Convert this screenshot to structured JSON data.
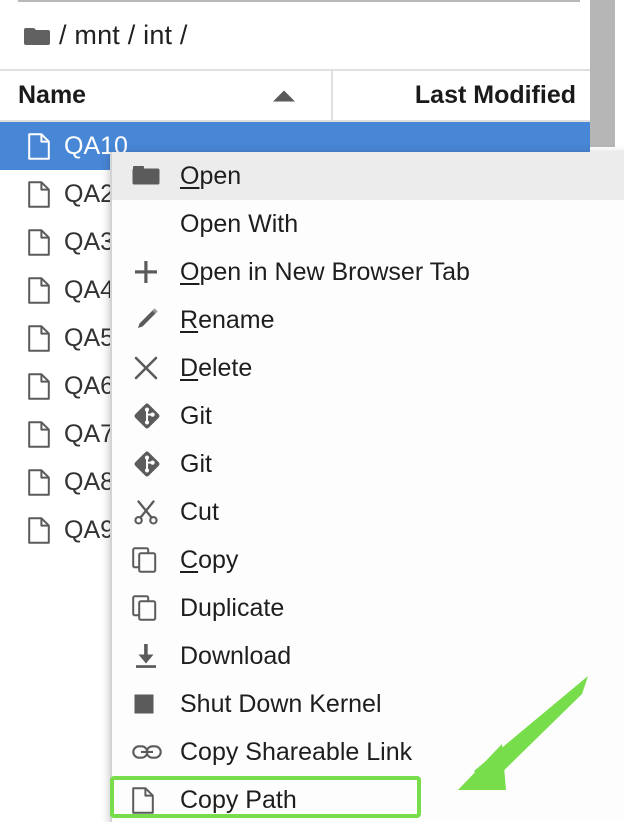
{
  "app": "JupyterLab File Browser",
  "breadcrumb": {
    "icon": "folder-icon",
    "path": "/ mnt / int /"
  },
  "columns": {
    "name": "Name",
    "last_modified": "Last Modified",
    "sort_icon": "caret-up-icon",
    "sort_direction": "ascending",
    "sorted_by": "Name"
  },
  "files": [
    {
      "name": "QA10",
      "icon": "file-icon",
      "selected": true
    },
    {
      "name": "QA2",
      "icon": "file-icon",
      "selected": false
    },
    {
      "name": "QA3",
      "icon": "file-icon",
      "selected": false
    },
    {
      "name": "QA4",
      "icon": "file-icon",
      "selected": false
    },
    {
      "name": "QA5",
      "icon": "file-icon",
      "selected": false
    },
    {
      "name": "QA6",
      "icon": "file-icon",
      "selected": false
    },
    {
      "name": "QA7",
      "icon": "file-icon",
      "selected": false
    },
    {
      "name": "QA8",
      "icon": "file-icon",
      "selected": false
    },
    {
      "name": "QA9",
      "icon": "file-icon",
      "selected": false
    }
  ],
  "context_menu": {
    "items": [
      {
        "label": "Open",
        "mnemonic": "O",
        "icon": "folder-icon",
        "active": true
      },
      {
        "label": "Open With",
        "mnemonic": "",
        "icon": "none",
        "active": false
      },
      {
        "label": "Open in New Browser Tab",
        "mnemonic": "O",
        "icon": "plus-icon",
        "active": false
      },
      {
        "label": "Rename",
        "mnemonic": "R",
        "icon": "pencil-icon",
        "active": false
      },
      {
        "label": "Delete",
        "mnemonic": "D",
        "icon": "close-x-icon",
        "active": false
      },
      {
        "label": "Git",
        "mnemonic": "",
        "icon": "git-icon",
        "active": false
      },
      {
        "label": "Git",
        "mnemonic": "",
        "icon": "git-icon",
        "active": false
      },
      {
        "label": "Cut",
        "mnemonic": "",
        "icon": "scissors-icon",
        "active": false
      },
      {
        "label": "Copy",
        "mnemonic": "C",
        "icon": "copy-icon",
        "active": false
      },
      {
        "label": "Duplicate",
        "mnemonic": "",
        "icon": "copy-icon",
        "active": false
      },
      {
        "label": "Download",
        "mnemonic": "",
        "icon": "download-icon",
        "active": false
      },
      {
        "label": "Shut Down Kernel",
        "mnemonic": "",
        "icon": "stop-square-icon",
        "active": false
      },
      {
        "label": "Copy Shareable Link",
        "mnemonic": "",
        "icon": "link-icon",
        "active": false
      },
      {
        "label": "Copy Path",
        "mnemonic": "",
        "icon": "file-icon",
        "active": false
      }
    ]
  },
  "annotation": {
    "target_label": "Copy Path",
    "highlight_color": "#78dd4a",
    "arrow_color": "#78dd4a",
    "arrow_icon": "arrow-pointing-down-left-icon"
  },
  "scrollbar": {
    "orientation": "vertical",
    "thumb_color": "#b6b6b6"
  },
  "colors": {
    "selection": "#4887d6",
    "menu_hover": "#ececec",
    "text": "#1e1e1e",
    "icon": "#5b5b5b"
  }
}
